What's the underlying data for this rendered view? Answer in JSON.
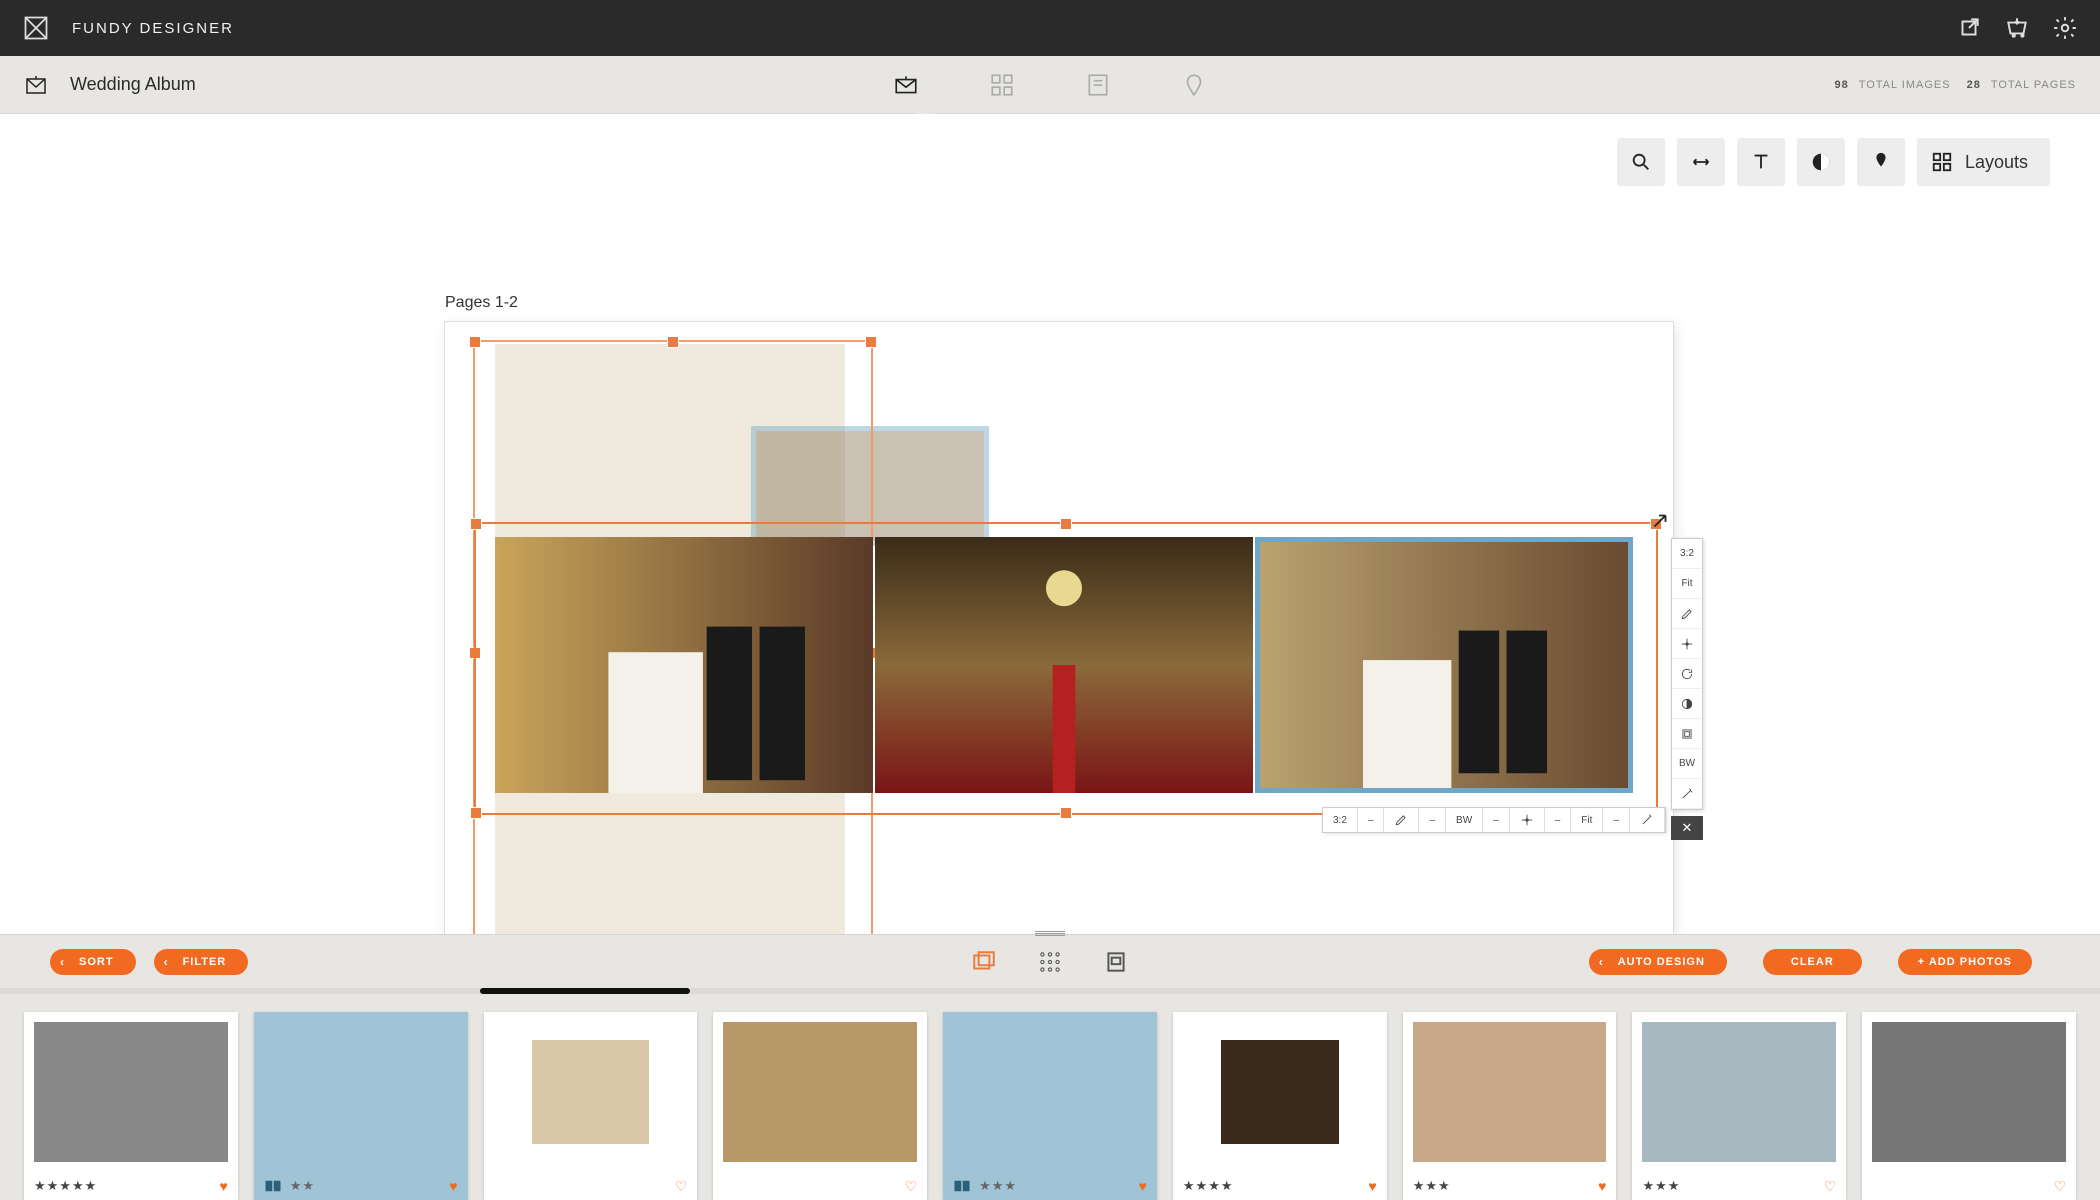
{
  "app": {
    "name": "FUNDY DESIGNER"
  },
  "project": {
    "name": "Wedding Album"
  },
  "stats": {
    "total_images": "98",
    "total_images_label": "TOTAL IMAGES",
    "total_pages": "28",
    "total_pages_label": "TOTAL PAGES"
  },
  "pages_label": "Pages 1-2",
  "layouts_btn": "Layouts",
  "side_tools": {
    "ratio": "3:2",
    "fit": "Fit",
    "bw": "BW"
  },
  "bottom_tools": {
    "ratio": "3:2",
    "bw": "BW",
    "fit": "Fit"
  },
  "tray": {
    "sort": "SORT",
    "filter": "FILTER",
    "auto": "AUTO DESIGN",
    "clear": "CLEAR",
    "add": "+  ADD PHOTOS"
  },
  "thumbs": [
    {
      "stars": 5,
      "fav": true,
      "sel": false,
      "book": false,
      "bw": true
    },
    {
      "stars": 2,
      "fav": true,
      "sel": true,
      "book": true,
      "bw": false
    },
    {
      "stars": 0,
      "fav": false,
      "sel": false,
      "book": false,
      "bw": false
    },
    {
      "stars": 0,
      "fav": false,
      "sel": false,
      "book": false,
      "bw": false
    },
    {
      "stars": 3,
      "fav": true,
      "sel": true,
      "book": true,
      "bw": false
    },
    {
      "stars": 4,
      "fav": true,
      "sel": false,
      "book": false,
      "bw": false
    },
    {
      "stars": 3,
      "fav": true,
      "sel": false,
      "book": false,
      "bw": false
    },
    {
      "stars": 3,
      "fav": false,
      "sel": false,
      "book": false,
      "bw": false
    },
    {
      "stars": 0,
      "fav": false,
      "sel": false,
      "book": false,
      "bw": true
    }
  ]
}
